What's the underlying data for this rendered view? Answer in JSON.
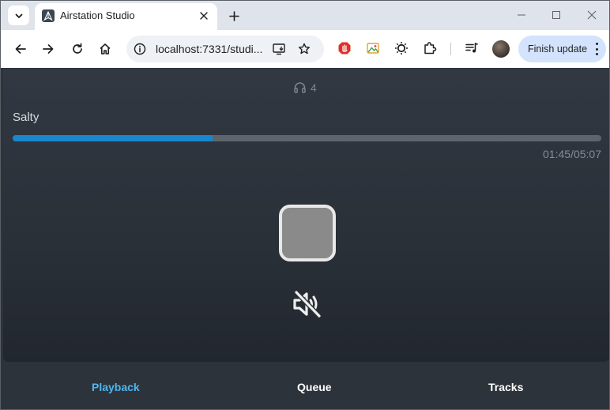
{
  "browser": {
    "tab_title": "Airstation Studio",
    "url": "localhost:7331/studi...",
    "update_button_label": "Finish update"
  },
  "player": {
    "listener_count": "4",
    "track_title": "Salty",
    "progress_fraction": 0.34,
    "elapsed": "01:45",
    "separator": "/",
    "duration": "05:07",
    "muted": true
  },
  "nav": {
    "items": [
      {
        "label": "Playback",
        "active": true
      },
      {
        "label": "Queue",
        "active": false
      },
      {
        "label": "Tracks",
        "active": false
      }
    ]
  },
  "colors": {
    "accent": "#1a86cf",
    "active_nav": "#4fb6ee",
    "nav_text": "#ffffff",
    "app_bg": "#2d333b"
  },
  "icons": {
    "listeners": "headphones-icon",
    "stop": "stop-icon",
    "volume": "volume-muted-icon"
  }
}
